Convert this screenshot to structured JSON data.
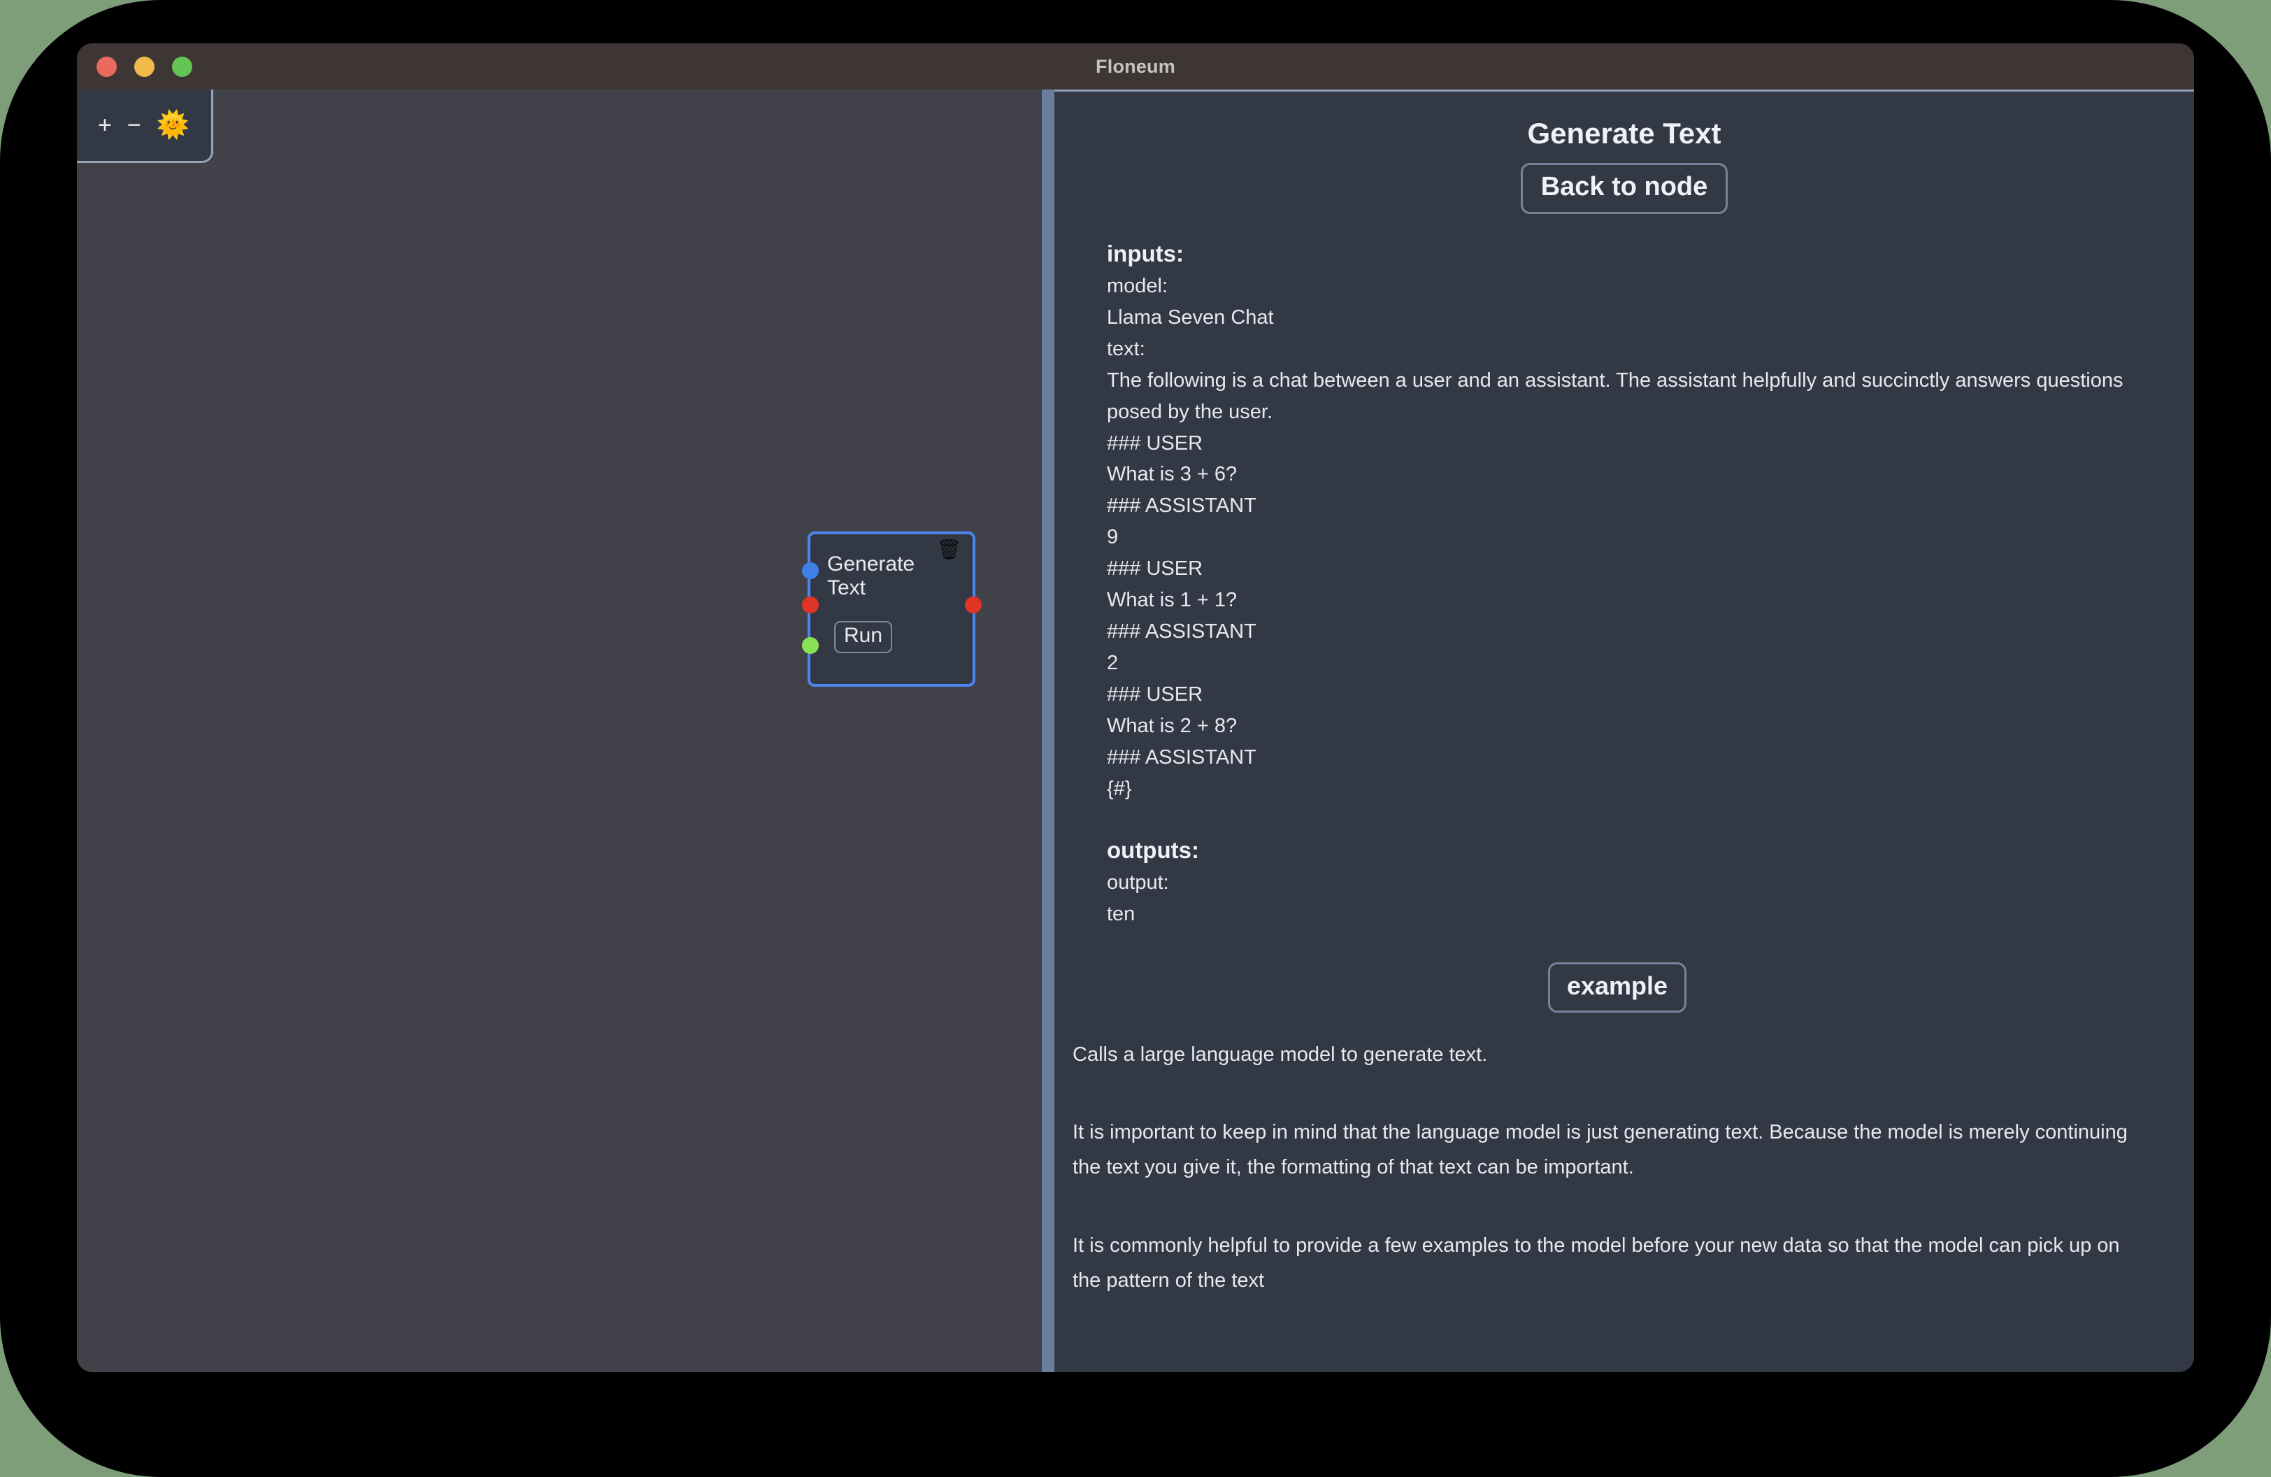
{
  "window": {
    "title": "Floneum",
    "traffic_lights": [
      {
        "name": "close",
        "color": "#eb6a5e"
      },
      {
        "name": "minimize",
        "color": "#f1bb4c"
      },
      {
        "name": "maximize",
        "color": "#62c554"
      }
    ]
  },
  "canvas": {
    "toolbar": {
      "zoom_in_label": "+",
      "zoom_out_label": "−",
      "theme_toggle_icon": "🌞"
    },
    "node": {
      "title": "Generate Text",
      "run_label": "Run",
      "delete_icon": "🗑",
      "ports": {
        "model_in": "#3f7fe8",
        "text_in": "#e03525",
        "run_in": "#8ae154",
        "output_out": "#e03525"
      }
    }
  },
  "panel": {
    "title": "Generate Text",
    "back_button_label": "Back to node",
    "inputs_heading": "inputs:",
    "inputs": [
      {
        "label": "model:",
        "value": "Llama Seven Chat"
      },
      {
        "label": "text:",
        "value": "The following is a chat between a user and an assistant. The assistant helpfully and succinctly answers questions posed by the user.\n### USER\nWhat is 3 + 6?\n### ASSISTANT\n9\n### USER\nWhat is 1 + 1?\n### ASSISTANT\n2\n### USER\nWhat is 2 + 8?\n### ASSISTANT\n{#}"
      }
    ],
    "outputs_heading": "outputs:",
    "outputs": [
      {
        "label": "output:",
        "value": "ten"
      }
    ],
    "example_button_label": "example",
    "description_paragraphs": [
      "Calls a large language model to generate text.",
      "It is important to keep in mind that the language model is just generating text. Because the model is merely continuing the text you give it, the formatting of that text can be important.",
      "It is commonly helpful to provide a few examples to the model before your new data so that the model can pick up on the pattern of the text"
    ]
  },
  "colors": {
    "titlebar": "#3e3635",
    "canvas_bg": "#414249",
    "panel_bg": "#323945",
    "divider": "#6d7e9c",
    "node_border": "#4d85f0",
    "desktop": "#7d9e79"
  }
}
